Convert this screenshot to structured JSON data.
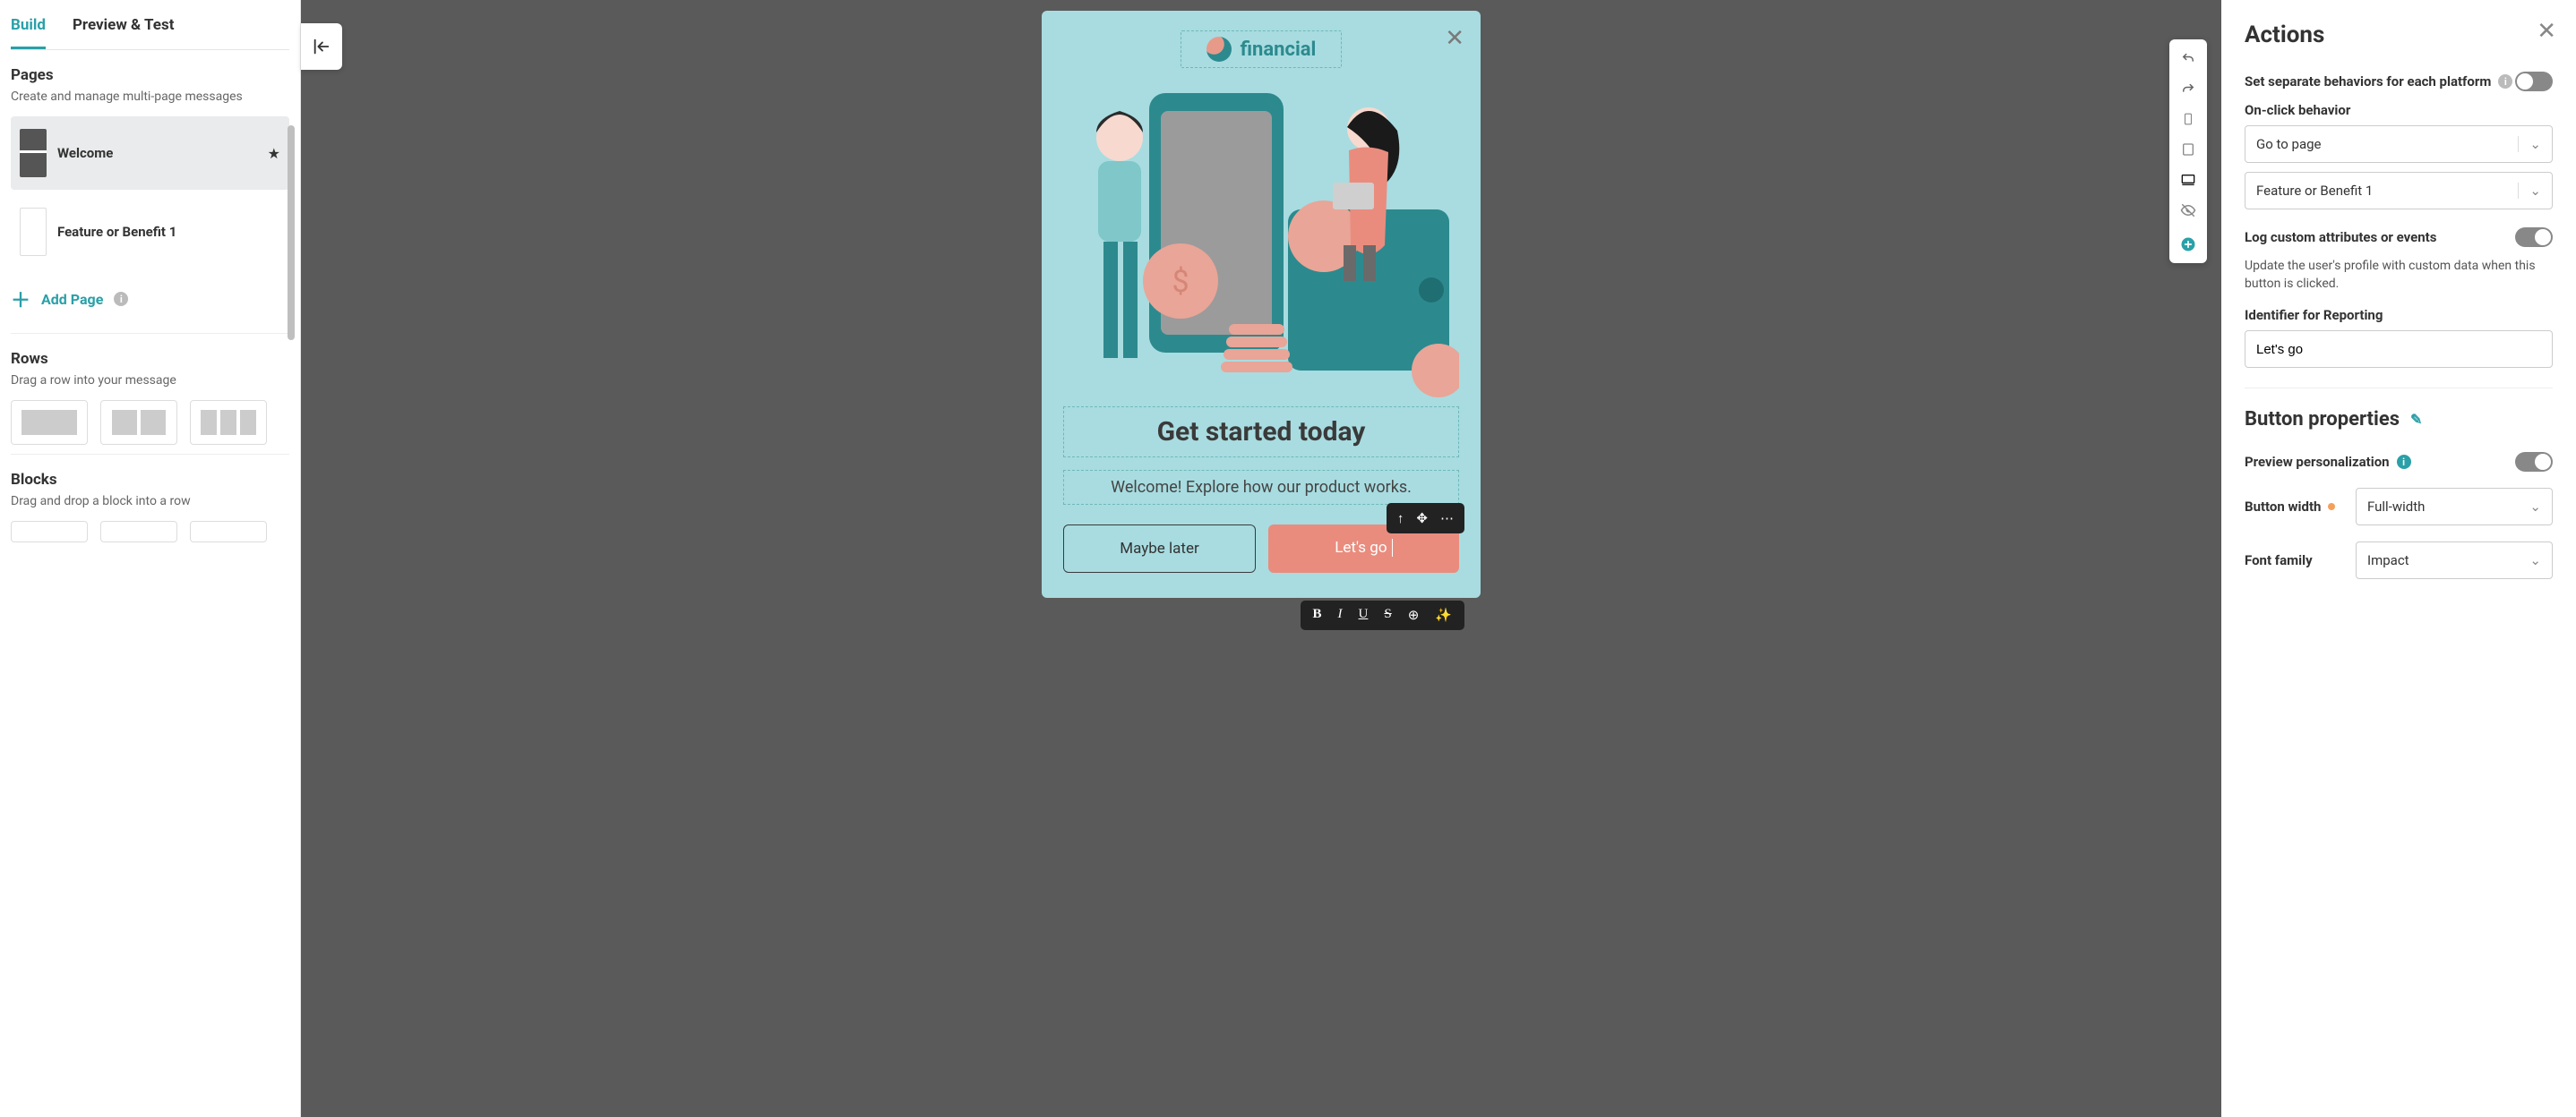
{
  "tabs": {
    "build": "Build",
    "preview": "Preview & Test"
  },
  "pages": {
    "title": "Pages",
    "desc": "Create and manage multi-page messages",
    "items": [
      {
        "label": "Welcome",
        "starred": true
      },
      {
        "label": "Feature or Benefit 1",
        "starred": false
      }
    ],
    "add": "Add Page"
  },
  "rows": {
    "title": "Rows",
    "desc": "Drag a row into your message"
  },
  "blocks": {
    "title": "Blocks",
    "desc": "Drag and drop a block into a row"
  },
  "canvas": {
    "brand": "financial",
    "headline": "Get started today",
    "subline": "Welcome! Explore how our product works.",
    "btn_secondary": "Maybe later",
    "btn_primary": "Let's go"
  },
  "actions": {
    "title": "Actions",
    "separate": "Set separate behaviors for each platform",
    "onclick_label": "On-click behavior",
    "onclick_value": "Go to page",
    "onclick_target": "Feature or Benefit 1",
    "log_label": "Log custom attributes or events",
    "log_desc": "Update the user's profile with custom data when this button is clicked.",
    "identifier_label": "Identifier for Reporting",
    "identifier_value": "Let's go"
  },
  "button_props": {
    "title": "Button properties",
    "preview_personalization": "Preview personalization",
    "width_label": "Button width",
    "width_value": "Full-width",
    "font_label": "Font family",
    "font_value": "Impact"
  }
}
